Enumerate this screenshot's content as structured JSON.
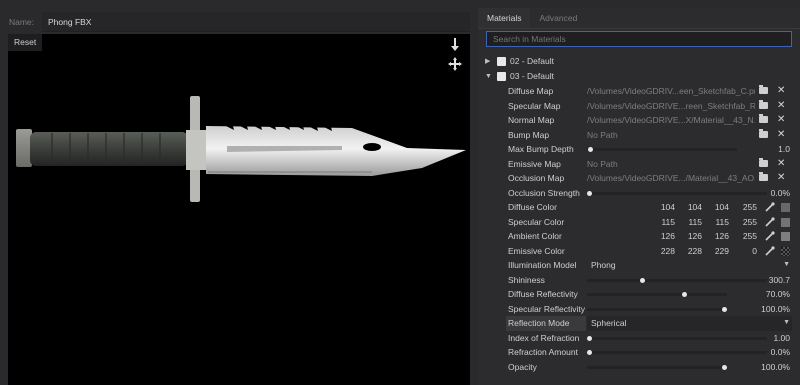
{
  "name_row": {
    "label": "Name:",
    "value": "Phong FBX"
  },
  "viewport": {
    "reset_label": "Reset",
    "tools": [
      "move-down-icon",
      "move-all-icon"
    ]
  },
  "tabs": [
    {
      "label": "Materials",
      "active": true
    },
    {
      "label": "Advanced",
      "active": false
    }
  ],
  "search": {
    "placeholder": "Search in Materials"
  },
  "groups": [
    {
      "name": "02 - Default",
      "expanded": false
    },
    {
      "name": "03 - Default",
      "expanded": true
    }
  ],
  "properties": {
    "diffuse_map": {
      "label": "Diffuse Map",
      "path": "/Volumes/VideoGDRIV...een_Sketchfab_C.png"
    },
    "specular_map": {
      "label": "Specular Map",
      "path": "/Volumes/VideoGDRIVE...reen_Sketchfab_R.png"
    },
    "normal_map": {
      "label": "Normal Map",
      "path": "/Volumes/VideoGDRIVE...X/Material__43_N.png"
    },
    "bump_map": {
      "label": "Bump Map",
      "path": "No Path"
    },
    "max_bump_depth": {
      "label": "Max Bump Depth",
      "value": "1.0",
      "level": 0.01
    },
    "emissive_map": {
      "label": "Emissive Map",
      "path": "No Path"
    },
    "occlusion_map": {
      "label": "Occlusion Map",
      "path": "/Volumes/VideoGDRIVE.../Material__43_AO.png"
    },
    "occlusion_strength": {
      "label": "Occlusion Strength",
      "value": "0.0%",
      "level": 0.0
    },
    "diffuse_color": {
      "label": "Diffuse Color",
      "r": "104",
      "g": "104",
      "b": "104",
      "a": "255",
      "swatch": "#686868"
    },
    "specular_color": {
      "label": "Specular Color",
      "r": "115",
      "g": "115",
      "b": "115",
      "a": "255",
      "swatch": "#737373"
    },
    "ambient_color": {
      "label": "Ambient Color",
      "r": "126",
      "g": "126",
      "b": "126",
      "a": "255",
      "swatch": "#7e7e7e"
    },
    "emissive_color": {
      "label": "Emissive Color",
      "r": "228",
      "g": "228",
      "b": "229",
      "a": "0",
      "swatch": "#e4e4e5"
    },
    "illumination_model": {
      "label": "Illumination Model",
      "value": "Phong"
    },
    "shininess": {
      "label": "Shininess",
      "value": "300.7",
      "level": 0.3
    },
    "diffuse_reflectivity": {
      "label": "Diffuse Reflectivity",
      "value": "70.0%",
      "level": 0.7
    },
    "specular_reflectivity": {
      "label": "Specular Reflectivity",
      "value": "100.0%",
      "level": 1.0
    },
    "reflection_mode": {
      "label": "Reflection Mode",
      "value": "Spherical"
    },
    "index_of_refraction": {
      "label": "Index of Refraction",
      "value": "1.00",
      "level": 0.0
    },
    "refraction_amount": {
      "label": "Refraction Amount",
      "value": "0.0%",
      "level": 0.0
    },
    "opacity": {
      "label": "Opacity",
      "value": "100.0%",
      "level": 1.0
    }
  },
  "colors": {
    "accent": "#3d63b8",
    "viewport_bg": "#000000",
    "panel_bg": "#2c2c2e"
  }
}
